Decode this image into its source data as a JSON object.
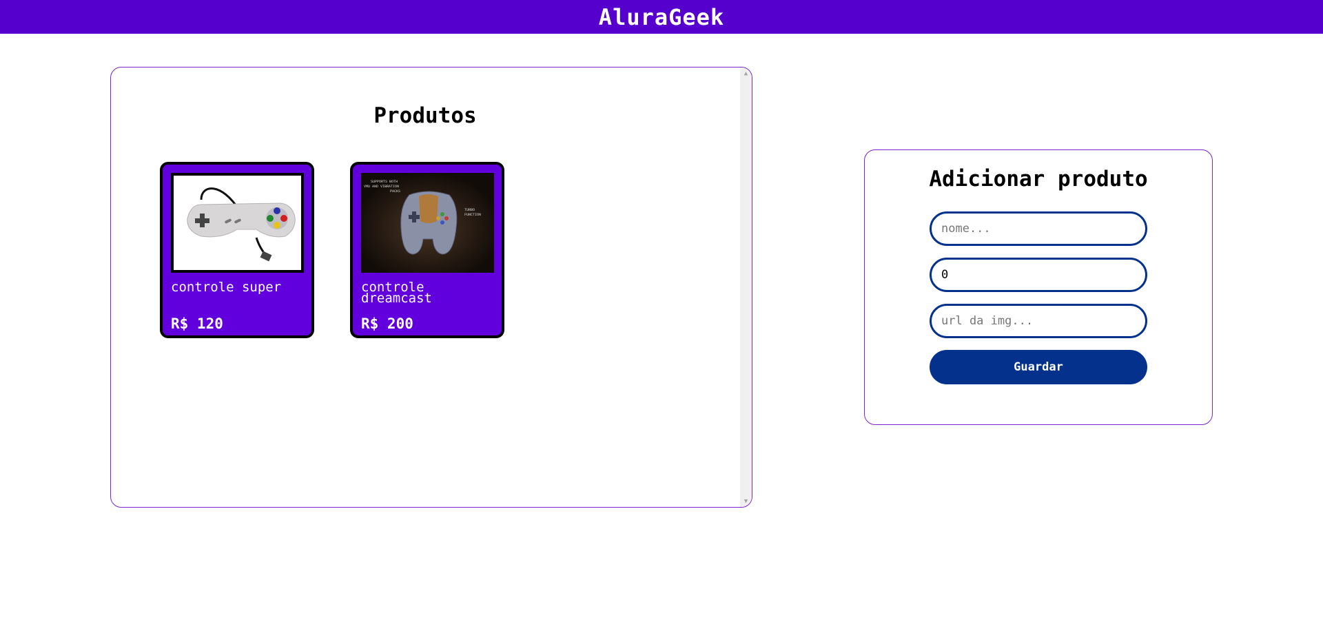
{
  "header": {
    "brand": "AluraGeek",
    "color": "#5500cc"
  },
  "products": {
    "title": "Produtos",
    "items": [
      {
        "name": "controle super",
        "price": "R$ 120",
        "image_icon": "snes-controller-image"
      },
      {
        "name": "controle dreamcast",
        "price": "R$ 200",
        "image_icon": "dreamcast-controller-image",
        "image_caption_top": "SUPPORTS BOTH",
        "image_caption_top2": "VMU AND VIBRATION",
        "image_caption_top3": "PACKS",
        "image_caption_right": "TURBO",
        "image_caption_right2": "FUNCTION"
      }
    ],
    "card_color": "#6200dd"
  },
  "form": {
    "title": "Adicionar produto",
    "name_placeholder": "nome...",
    "price_value": "0",
    "url_placeholder": "url da img...",
    "submit_label": "Guardar",
    "accent_color": "#03318c"
  }
}
